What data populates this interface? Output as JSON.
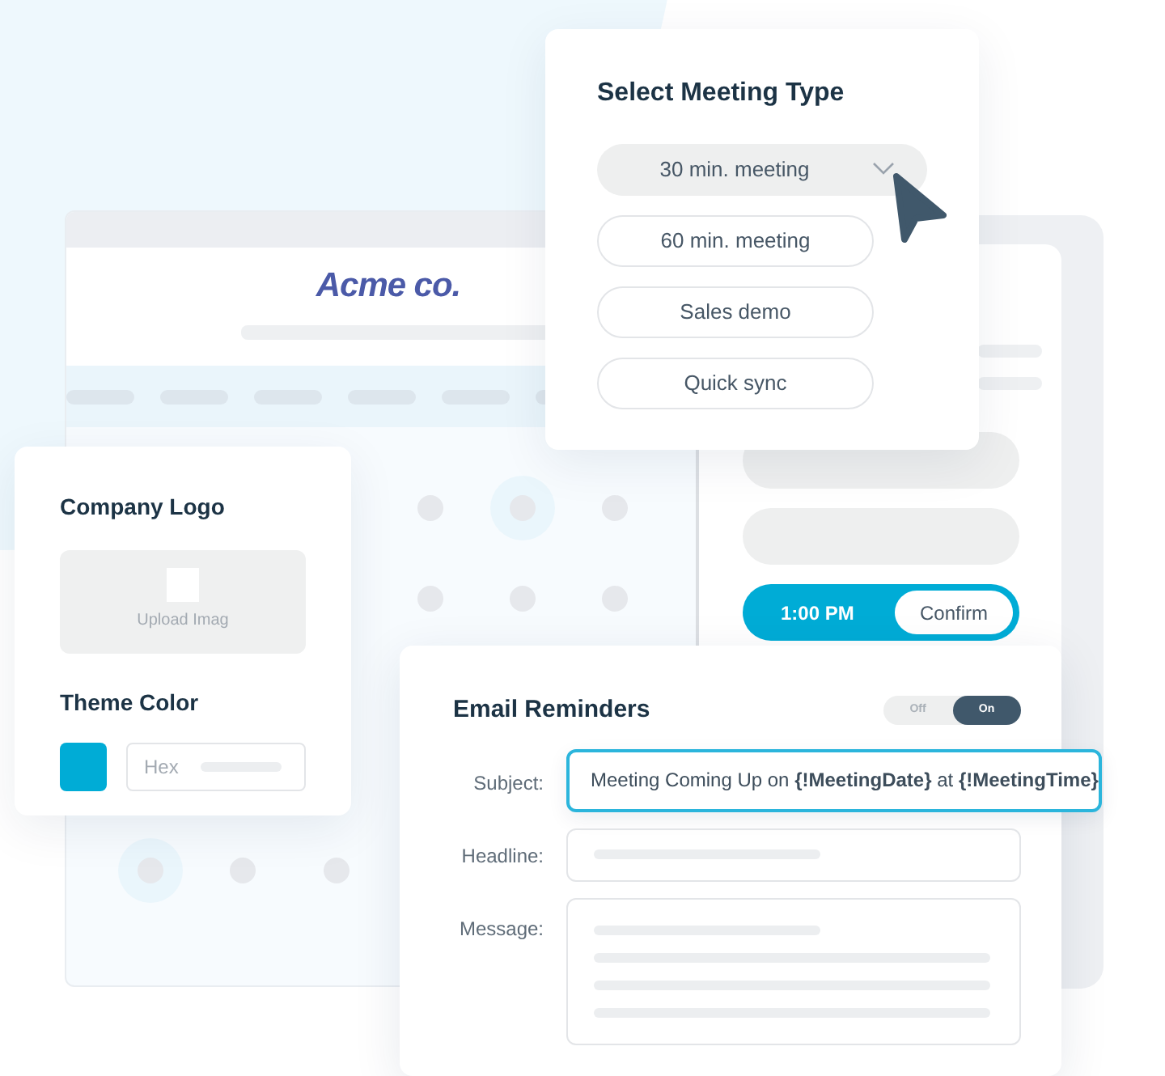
{
  "brand": {
    "name": "Acme co."
  },
  "meeting_types": {
    "title": "Select Meeting Type",
    "options": [
      {
        "label": "30 min. meeting",
        "selected": true
      },
      {
        "label": "60 min. meeting",
        "selected": false
      },
      {
        "label": "Sales demo",
        "selected": false
      },
      {
        "label": "Quick sync",
        "selected": false
      }
    ]
  },
  "time_picker": {
    "time": "1:00 PM",
    "button": "Confirm"
  },
  "branding": {
    "logo_title": "Company Logo",
    "upload_label": "Upload Imag",
    "theme_title": "Theme Color",
    "hex_placeholder": "Hex"
  },
  "email_reminders": {
    "title": "Email Reminders",
    "toggle": {
      "off_label": "Off",
      "on_label": "On",
      "on": true
    },
    "fields": [
      {
        "label": "Subject:",
        "kind": "text",
        "value": "Meeting Coming Up on **{!MeetingDate}** at **{!MeetingTime}**"
      },
      {
        "label": "Headline:",
        "kind": "line"
      },
      {
        "label": "Message:",
        "kind": "area"
      }
    ]
  }
}
